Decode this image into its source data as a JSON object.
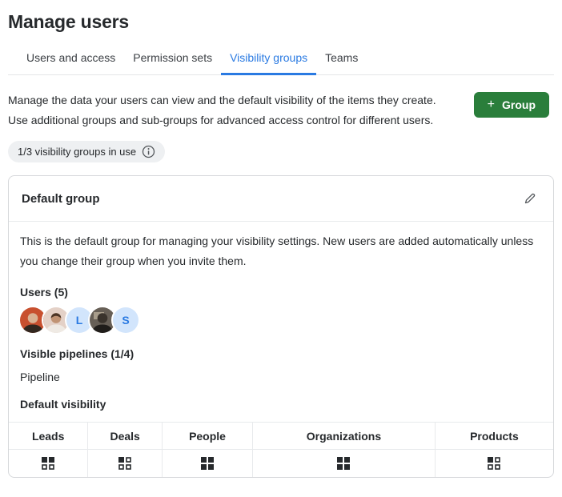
{
  "page": {
    "title": "Manage users"
  },
  "tabs": {
    "items": [
      {
        "label": "Users and access",
        "active": false
      },
      {
        "label": "Permission sets",
        "active": false
      },
      {
        "label": "Visibility groups",
        "active": true
      },
      {
        "label": "Teams",
        "active": false
      }
    ]
  },
  "intro": {
    "description": "Manage the data your users can view and the default visibility of the items they create. Use additional groups and sub-groups for advanced access control for different users.",
    "add_group_button": {
      "icon": "plus-icon",
      "plus_glyph": "+",
      "label": "Group",
      "color": "#2a7e3b"
    },
    "usage_badge": {
      "text": "1/3 visibility groups in use",
      "icon": "info-icon"
    }
  },
  "group_card": {
    "title": "Default group",
    "edit_icon": "pencil-icon",
    "description": "This is the default group for managing your visibility settings. New users are added automatically unless you change their group when you invite them.",
    "users": {
      "heading": "Users (5)",
      "avatars": [
        {
          "type": "photo",
          "bg": "#c8502f",
          "head": "#d9b294",
          "body": "#32271f"
        },
        {
          "type": "photo",
          "bg": "#e4d1c7",
          "head": "#c09374",
          "hair": "#4c3526",
          "body": "#efeae4"
        },
        {
          "type": "initial",
          "initial": "L",
          "bg": "#d2e5fc",
          "color": "#2a7ae2"
        },
        {
          "type": "photo",
          "bg": "#675f56",
          "head": "#3a332c",
          "body": "#201d1a",
          "accent": "#a89d8b"
        },
        {
          "type": "initial",
          "initial": "S",
          "bg": "#d2e5fc",
          "color": "#2a7ae2"
        }
      ]
    },
    "pipelines": {
      "heading": "Visible pipelines (1/4)",
      "value": "Pipeline"
    },
    "default_visibility": {
      "heading": "Default visibility",
      "icon_name": "visibility-grid-icon",
      "columns": [
        {
          "label": "Leads",
          "quadrants": [
            1,
            1,
            0,
            0
          ]
        },
        {
          "label": "Deals",
          "quadrants": [
            1,
            0,
            0,
            0
          ]
        },
        {
          "label": "People",
          "quadrants": [
            1,
            1,
            1,
            1
          ]
        },
        {
          "label": "Organizations",
          "quadrants": [
            1,
            1,
            1,
            1
          ]
        },
        {
          "label": "Products",
          "quadrants": [
            1,
            0,
            0,
            0
          ]
        }
      ]
    }
  },
  "colors": {
    "accent_blue": "#2a7ae2",
    "button_green": "#2a7e3b",
    "text": "#26292c",
    "card_border": "#d6d8db",
    "divider": "#e8eaec",
    "badge_bg": "#eef0f2"
  }
}
